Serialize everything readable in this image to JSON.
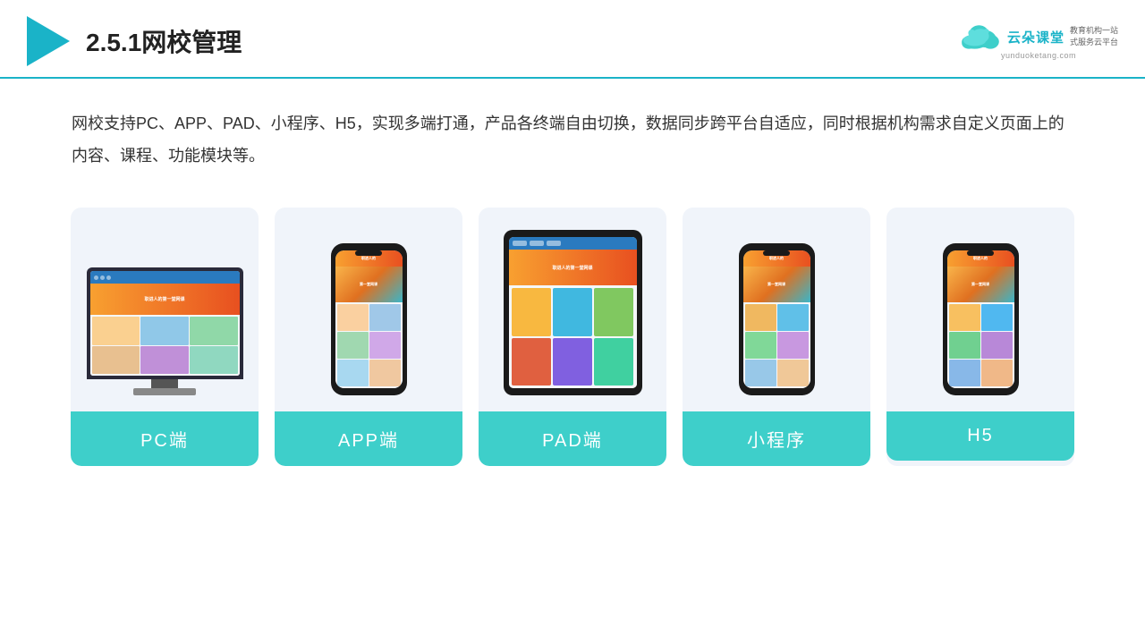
{
  "header": {
    "title": "2.5.1网校管理",
    "brand": {
      "name": "云朵课堂",
      "url": "yunduoketang.com",
      "tagline": "教育机构一站\n式服务云平台"
    }
  },
  "description": "网校支持PC、APP、PAD、小程序、H5，实现多端打通，产品各终端自由切换，数据同步跨平台自适应，同时根据机构需求自定义页面上的内容、课程、功能模块等。",
  "cards": [
    {
      "id": "pc",
      "label": "PC端"
    },
    {
      "id": "app",
      "label": "APP端"
    },
    {
      "id": "pad",
      "label": "PAD端"
    },
    {
      "id": "miniprogram",
      "label": "小程序"
    },
    {
      "id": "h5",
      "label": "H5"
    }
  ],
  "accent_color": "#3ecfca"
}
